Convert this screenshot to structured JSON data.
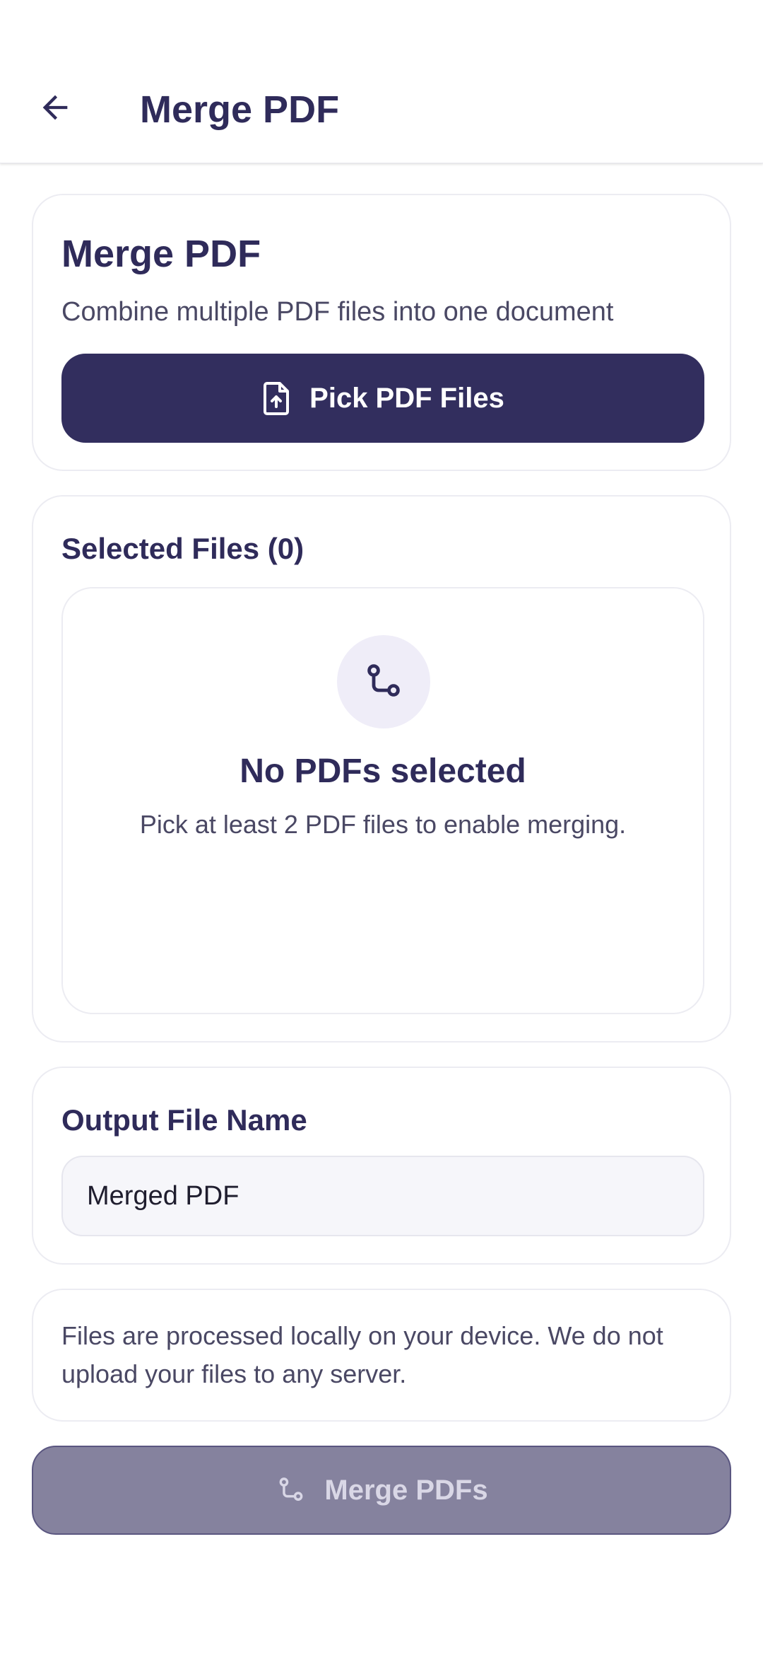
{
  "app_bar": {
    "title": "Merge PDF",
    "back_icon": "arrow-back-icon"
  },
  "pick_card": {
    "title": "Merge PDF",
    "description": "Combine multiple PDF files into one document",
    "button_label": "Pick PDF Files",
    "button_icon": "file-upload-icon"
  },
  "selected_files": {
    "title": "Selected Files (0)",
    "empty_icon": "merge-icon",
    "empty_title": "No PDFs selected",
    "empty_subtitle": "Pick at least 2 PDF files to enable merging."
  },
  "output": {
    "title": "Output File Name",
    "value": "Merged PDF"
  },
  "privacy_note": "Files are processed locally on your device. We do not upload your files to any server.",
  "merge_button": {
    "label": "Merge PDFs",
    "icon": "merge-icon",
    "enabled": false
  },
  "colors": {
    "primary": "#322e5e",
    "text_dark": "#2f2b5a",
    "text_muted": "#4a4864",
    "disabled_button": "#85829e",
    "border": "#ececf2"
  }
}
